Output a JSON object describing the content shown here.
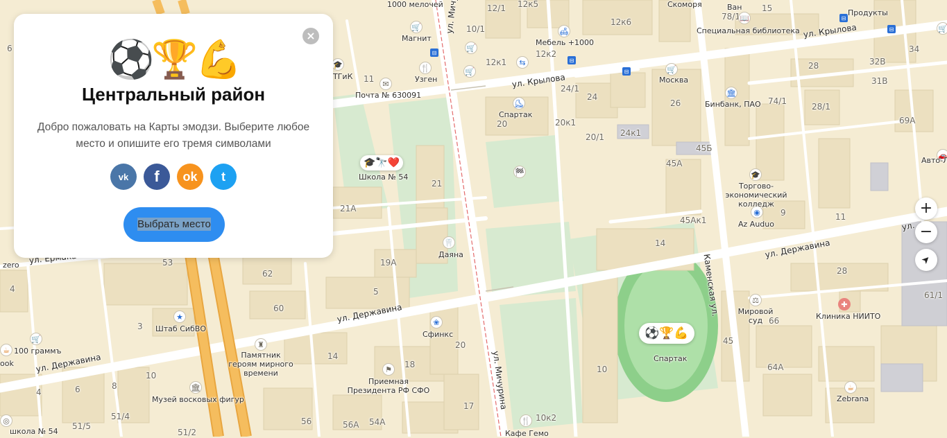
{
  "card": {
    "emoji": "⚽🏆💪",
    "title": "Центральный район",
    "text": "Добро пожаловать на Карты эмодзи. Выберите любое место и опишите его тремя символами",
    "close_label": "×",
    "share": {
      "vk": "vk",
      "fb": "f",
      "ok": "ok",
      "tw": "t"
    },
    "choose_button": "Выбрать место"
  },
  "controls": {
    "zoom_in": "+",
    "zoom_out": "−",
    "locate": "➤"
  },
  "pins": {
    "school": {
      "emoji": "🎓🔭❤️",
      "label": "Школа № 54"
    },
    "spartak": {
      "emoji": "⚽🏆💪",
      "label": "Спартак"
    }
  },
  "streets": {
    "michurina_top": "ул. Мичурина",
    "michurina_bottom": "ул. Мичурина",
    "krylova_mid": "ул. Крылова",
    "krylova_right": "ул. Крылова",
    "derzhavina_mid": "ул. Державина",
    "derzhavina_right": "ул. Державина",
    "derzhavina_left": "ул. Державина",
    "ermaka": "ул. Ермака",
    "kamenskaya": "Каменская ул.",
    "right_edge": "ул."
  },
  "places": {
    "melochey": "1000 мелочей",
    "magnit": "Магнит",
    "uzgen": "Узген",
    "tgik": "ТГиК",
    "pochta": "Почта № 630091",
    "mebel": "Мебель +1000",
    "spartak_top": "Спартак",
    "moskva": "Москва",
    "skomorya": "Скоморя",
    "van": "Ван",
    "library": "Специальная библиотека",
    "produkty": "Продукты",
    "binbank": "Бинбанк, ПАО",
    "college": "Торгово-экономический колледж",
    "azaudio": "Az Auduo",
    "avto": "Авто-Л",
    "dayana": "Даяна",
    "sfinks": "Сфинкс",
    "shtab": "Штаб СибВО",
    "monument": "Памятник героям мирного времени",
    "priemnaya": "Приемная Президента РФ СФО",
    "museum": "Музей восковых фигур",
    "grams": "100 граммъ",
    "zero": "zero",
    "ook": "ook",
    "school54_bottom": "школа № 54",
    "court": "Мировой суд",
    "clinic": "Клиника НИИТО",
    "zebrana": "Zebrana",
    "gemo": "Кафе Гемо"
  },
  "houses": {
    "h6": "6",
    "h12_1": "12/1",
    "h12k5": "12к5",
    "h12k6": "12к6",
    "h10_1": "10/1",
    "h12k2": "12к2",
    "h12k1": "12к1",
    "h11": "11",
    "h78_1": "78/1",
    "h15": "15",
    "h34": "34",
    "h28a": "28",
    "h32v": "32В",
    "h31v": "31В",
    "h24_1": "24/1",
    "h24": "24",
    "h26": "26",
    "h74_1": "74/1",
    "h28_1": "28/1",
    "h69a": "69А",
    "h20": "20",
    "h20k1": "20к1",
    "h20_1": "20/1",
    "h24k1": "24к1",
    "h45b": "45Б",
    "h45a": "45А",
    "h21": "21",
    "h21a": "21А",
    "h9": "9",
    "h11b": "11",
    "h45ak1": "45Ак1",
    "h53": "53",
    "h19a": "19А",
    "h62": "62",
    "h14a": "14",
    "h4": "4",
    "h5": "5",
    "h28b": "28",
    "h61_1": "61/1",
    "h60": "60",
    "h3": "3",
    "h20b": "20",
    "h14b": "14",
    "h18": "18",
    "h66": "66",
    "h45": "45",
    "h10": "10",
    "h64a": "64А",
    "h6b": "6",
    "h8": "8",
    "h10b": "10",
    "h4b": "4",
    "h17": "17",
    "h51_5": "51/5",
    "h51_4": "51/4",
    "h56": "56",
    "h56a": "56А",
    "h54a": "54А",
    "h51_2": "51/2",
    "h10k2": "10к2"
  },
  "colors": {
    "background": "#f5ecd3",
    "major_road": "#f3b450",
    "button_blue": "#2e8df0",
    "vk": "#4a76a8",
    "fb": "#3b5998",
    "ok": "#f7931e",
    "tw": "#1da1f2",
    "park": "#d5ecd3"
  }
}
